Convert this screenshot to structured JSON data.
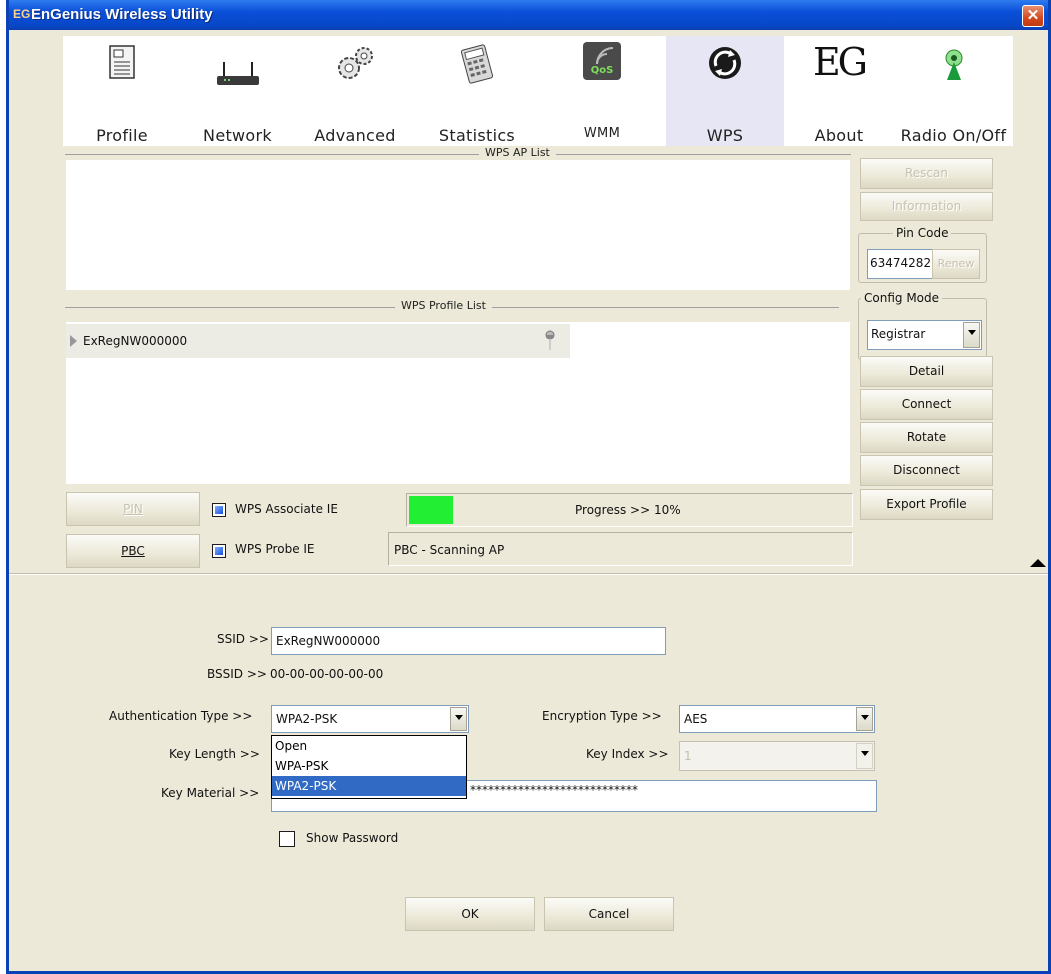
{
  "window": {
    "title": "EnGenius Wireless Utility",
    "app_icon_text": "EG"
  },
  "toolbar": {
    "items": [
      {
        "label": "Profile",
        "icon": "profile-icon"
      },
      {
        "label": "Network",
        "icon": "network-icon"
      },
      {
        "label": "Advanced",
        "icon": "gears-icon"
      },
      {
        "label": "Statistics",
        "icon": "calculator-icon"
      },
      {
        "label": "WMM",
        "icon": "qos-icon",
        "icon_text": "QoS"
      },
      {
        "label": "WPS",
        "icon": "wps-icon"
      },
      {
        "label": "About",
        "icon": "eg-logo-icon",
        "icon_text": "EG"
      },
      {
        "label": "Radio On/Off",
        "icon": "radio-antenna-icon"
      }
    ],
    "active": "WPS"
  },
  "wps": {
    "ap_list_title": "WPS AP List",
    "profile_list_title": "WPS Profile List",
    "profile_rows": [
      {
        "name": "ExRegNW000000"
      }
    ],
    "buttons": {
      "rescan": "Rescan",
      "information": "Information",
      "renew": "Renew",
      "detail": "Detail",
      "connect": "Connect",
      "rotate": "Rotate",
      "disconnect": "Disconnect",
      "export_profile": "Export Profile",
      "pin": "PIN",
      "pbc": "PBC"
    },
    "pin_code_label": "Pin Code",
    "pin_code_value": "63474282",
    "config_mode_label": "Config Mode",
    "config_mode_value": "Registrar",
    "associate_ie_label": "WPS Associate IE",
    "probe_ie_label": "WPS Probe IE",
    "progress_text": "Progress >> 10%",
    "progress_value": 0.1,
    "status_text": "PBC - Scanning AP",
    "progress_color": "#22ee33"
  },
  "detail": {
    "ssid_label": "SSID >>",
    "ssid_value": "ExRegNW000000",
    "bssid_label": "BSSID >>",
    "bssid_value": "00-00-00-00-00-00",
    "auth_label": "Authentication Type >>",
    "auth_value": "WPA2-PSK",
    "auth_options": [
      "Open",
      "WPA-PSK",
      "WPA2-PSK"
    ],
    "auth_selected_index": 2,
    "enc_label": "Encryption Type >>",
    "enc_value": "AES",
    "keylen_label": "Key Length >>",
    "keyidx_label": "Key Index >>",
    "keyidx_value": "1",
    "keymat_label": "Key Material >>",
    "keymat_value": "****************************",
    "show_password_label": "Show Password",
    "ok_label": "OK",
    "cancel_label": "Cancel"
  }
}
